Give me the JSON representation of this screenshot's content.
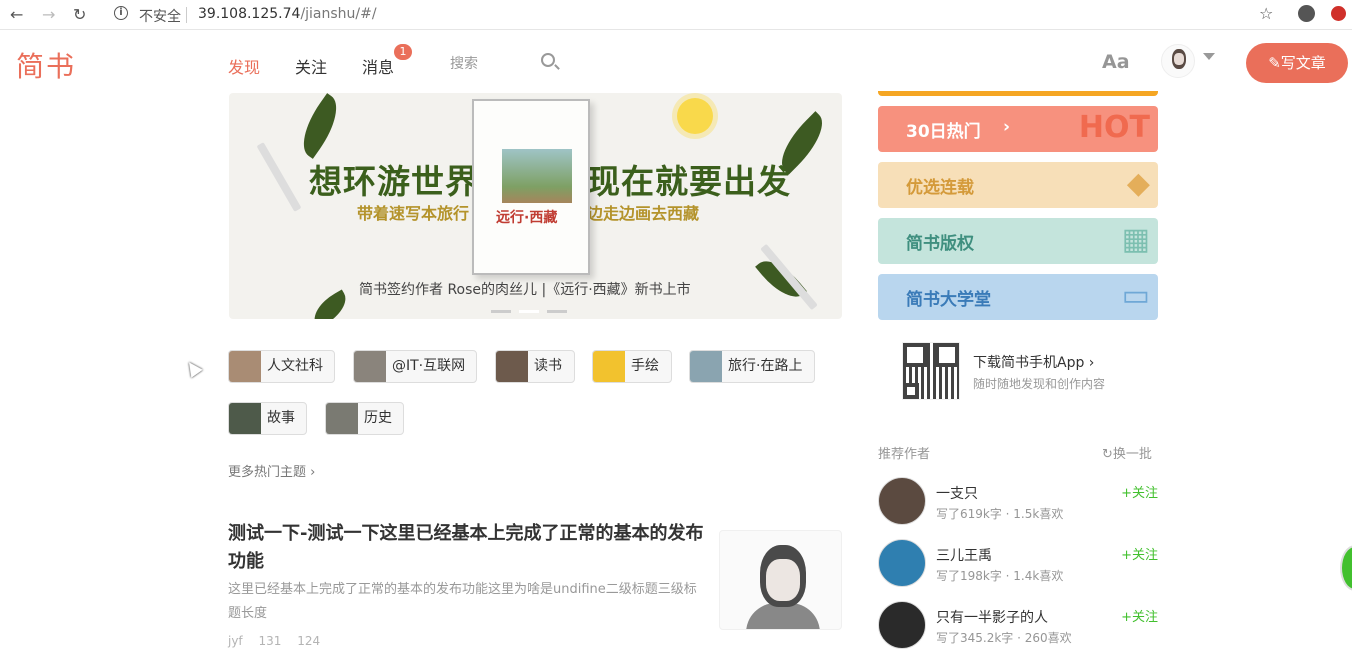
{
  "browser": {
    "insecure_label": "不安全",
    "url_host": "39.108.125.74",
    "url_path": "/jianshu/#/"
  },
  "header": {
    "logo": "简书",
    "nav": [
      "发现",
      "关注",
      "消息"
    ],
    "badge_count": "1",
    "search_placeholder": "搜索",
    "font_toggle": "Aa",
    "write_button": "写文章"
  },
  "banner": {
    "title_left": "想环游世界",
    "title_right": "现在就要出发",
    "sub_left": "带着速写本旅行",
    "sub_right": "边走边画去西藏",
    "book_title": "远行·西藏",
    "footer": "简书签约作者 Rose的肉丝儿 |《远行·西藏》新书上市"
  },
  "topics": [
    "人文社科",
    "@IT·互联网",
    "读书",
    "手绘",
    "旅行·在路上",
    "故事",
    "历史"
  ],
  "more_topics": "更多热门主题",
  "article": {
    "title": "测试一下-测试一下这里已经基本上完成了正常的基本的发布功能",
    "abstract": "这里已经基本上完成了正常的基本的发布功能这里为啥是undifine二级标题三级标题长度",
    "author": "jyf",
    "comments": "131",
    "likes": "124"
  },
  "sidebar": {
    "boards": [
      {
        "label": "30日热门",
        "decor": "HOT",
        "bg": "#f7917e",
        "decor_color": "#f06a4f"
      },
      {
        "label": "优选连载",
        "decor": "",
        "bg": "#f7dfb8",
        "decor_color": "#e4ae5a"
      },
      {
        "label": "简书版权",
        "decor": "",
        "bg": "#c4e4dc",
        "decor_color": "#7cbfb0"
      },
      {
        "label": "简书大学堂",
        "decor": "",
        "bg": "#b9d6ee",
        "decor_color": "#6fa8d6"
      }
    ],
    "download_title": "下载简书手机App",
    "download_sub": "随时随地发现和创作内容",
    "recommend_title": "推荐作者",
    "refresh": "换一批",
    "authors": [
      {
        "name": "一支只",
        "stats": "写了619k字 · 1.5k喜欢",
        "follow": "+关注"
      },
      {
        "name": "三儿王禹",
        "stats": "写了198k字 · 1.4k喜欢",
        "follow": "+关注"
      },
      {
        "name": "只有一半影子的人",
        "stats": "写了345.2k字 · 260喜欢",
        "follow": "+关注"
      }
    ]
  },
  "colors": {
    "brand": "#ea6f5a",
    "follow": "#42c02e"
  }
}
